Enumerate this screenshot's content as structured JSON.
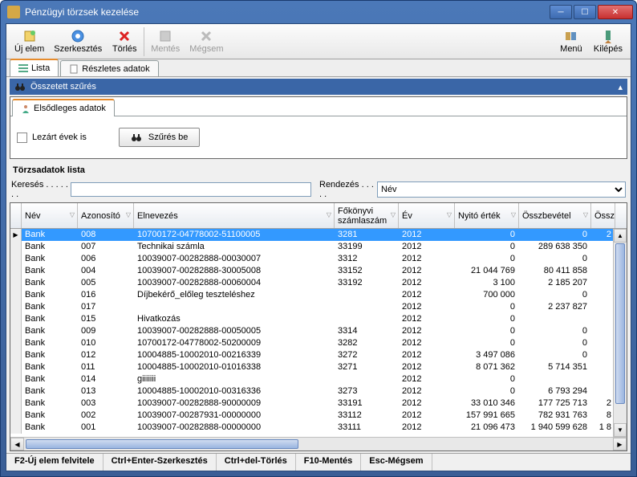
{
  "window": {
    "title": "Pénzügyi törzsek kezelése"
  },
  "toolbar": {
    "new": "Új elem",
    "edit": "Szerkesztés",
    "delete": "Törlés",
    "save": "Mentés",
    "cancel": "Mégsem",
    "menu": "Menü",
    "exit": "Kilépés"
  },
  "tabs": {
    "list": "Lista",
    "details": "Részletes adatok"
  },
  "filter": {
    "title": "Összetett szűrés",
    "close": "▴"
  },
  "panel": {
    "tab": "Elsődleges adatok",
    "closed_years": "Lezárt évek is",
    "filter_on": "Szűrés be"
  },
  "list": {
    "title": "Törzsadatok lista",
    "search_label": "Keresés . . . . . . .",
    "sort_label": "Rendezés . . . . .",
    "sort_value": "Név"
  },
  "columns": {
    "nev": "Név",
    "azon": "Azonosító",
    "elnev": "Elnevezés",
    "fokonyv": "Főkönyvi számlaszám",
    "ev": "Év",
    "nyito": "Nyitó érték",
    "osszb": "Összbevétel",
    "ossz": "Össz"
  },
  "rows": [
    {
      "nev": "Bank",
      "azon": "008",
      "elnev": "10700172-04778002-51100005",
      "fok": "3281",
      "ev": "2012",
      "ny": "0",
      "ob": "0",
      "os": "2"
    },
    {
      "nev": "Bank",
      "azon": "007",
      "elnev": "Technikai számla",
      "fok": "33199",
      "ev": "2012",
      "ny": "0",
      "ob": "289 638 350",
      "os": ""
    },
    {
      "nev": "Bank",
      "azon": "006",
      "elnev": "10039007-00282888-00030007",
      "fok": "3312",
      "ev": "2012",
      "ny": "0",
      "ob": "0",
      "os": ""
    },
    {
      "nev": "Bank",
      "azon": "004",
      "elnev": "10039007-00282888-30005008",
      "fok": "33152",
      "ev": "2012",
      "ny": "21 044 769",
      "ob": "80 411 858",
      "os": ""
    },
    {
      "nev": "Bank",
      "azon": "005",
      "elnev": "10039007-00282888-00060004",
      "fok": "33192",
      "ev": "2012",
      "ny": "3 100",
      "ob": "2 185 207",
      "os": ""
    },
    {
      "nev": "Bank",
      "azon": "016",
      "elnev": "Díjbekérő_előleg teszteléshez",
      "fok": "",
      "ev": "2012",
      "ny": "700 000",
      "ob": "0",
      "os": ""
    },
    {
      "nev": "Bank",
      "azon": "017",
      "elnev": "",
      "fok": "",
      "ev": "2012",
      "ny": "0",
      "ob": "2 237 827",
      "os": ""
    },
    {
      "nev": "Bank",
      "azon": "015",
      "elnev": "Hivatkozás",
      "fok": "",
      "ev": "2012",
      "ny": "0",
      "ob": "",
      "os": ""
    },
    {
      "nev": "Bank",
      "azon": "009",
      "elnev": "10039007-00282888-00050005",
      "fok": "3314",
      "ev": "2012",
      "ny": "0",
      "ob": "0",
      "os": ""
    },
    {
      "nev": "Bank",
      "azon": "010",
      "elnev": "10700172-04778002-50200009",
      "fok": "3282",
      "ev": "2012",
      "ny": "0",
      "ob": "0",
      "os": ""
    },
    {
      "nev": "Bank",
      "azon": "012",
      "elnev": "10004885-10002010-00216339",
      "fok": "3272",
      "ev": "2012",
      "ny": "3 497 086",
      "ob": "0",
      "os": ""
    },
    {
      "nev": "Bank",
      "azon": "011",
      "elnev": "10004885-10002010-01016338",
      "fok": "3271",
      "ev": "2012",
      "ny": "8 071 362",
      "ob": "5 714 351",
      "os": ""
    },
    {
      "nev": "Bank",
      "azon": "014",
      "elnev": "giiiiiii",
      "fok": "",
      "ev": "2012",
      "ny": "0",
      "ob": "",
      "os": ""
    },
    {
      "nev": "Bank",
      "azon": "013",
      "elnev": "10004885-10002010-00316336",
      "fok": "3273",
      "ev": "2012",
      "ny": "0",
      "ob": "6 793 294",
      "os": ""
    },
    {
      "nev": "Bank",
      "azon": "003",
      "elnev": "10039007-00282888-90000009",
      "fok": "33191",
      "ev": "2012",
      "ny": "33 010 346",
      "ob": "177 725 713",
      "os": "2"
    },
    {
      "nev": "Bank",
      "azon": "002",
      "elnev": "10039007-00287931-00000000",
      "fok": "33112",
      "ev": "2012",
      "ny": "157 991 665",
      "ob": "782 931 763",
      "os": "8"
    },
    {
      "nev": "Bank",
      "azon": "001",
      "elnev": "10039007-00282888-00000000",
      "fok": "33111",
      "ev": "2012",
      "ny": "21 096 473",
      "ob": "1 940 599 628",
      "os": "1 8"
    }
  ],
  "status": {
    "f2": "F2-Új elem felvitele",
    "ctrlenter": "Ctrl+Enter-Szerkesztés",
    "ctrldel": "Ctrl+del-Törlés",
    "f10": "F10-Mentés",
    "esc": "Esc-Mégsem"
  },
  "colw": {
    "ind": 14,
    "nev": 70,
    "azon": 70,
    "elnev": 250,
    "fok": 80,
    "ev": 70,
    "ny": 80,
    "ob": 90,
    "os": 30
  }
}
